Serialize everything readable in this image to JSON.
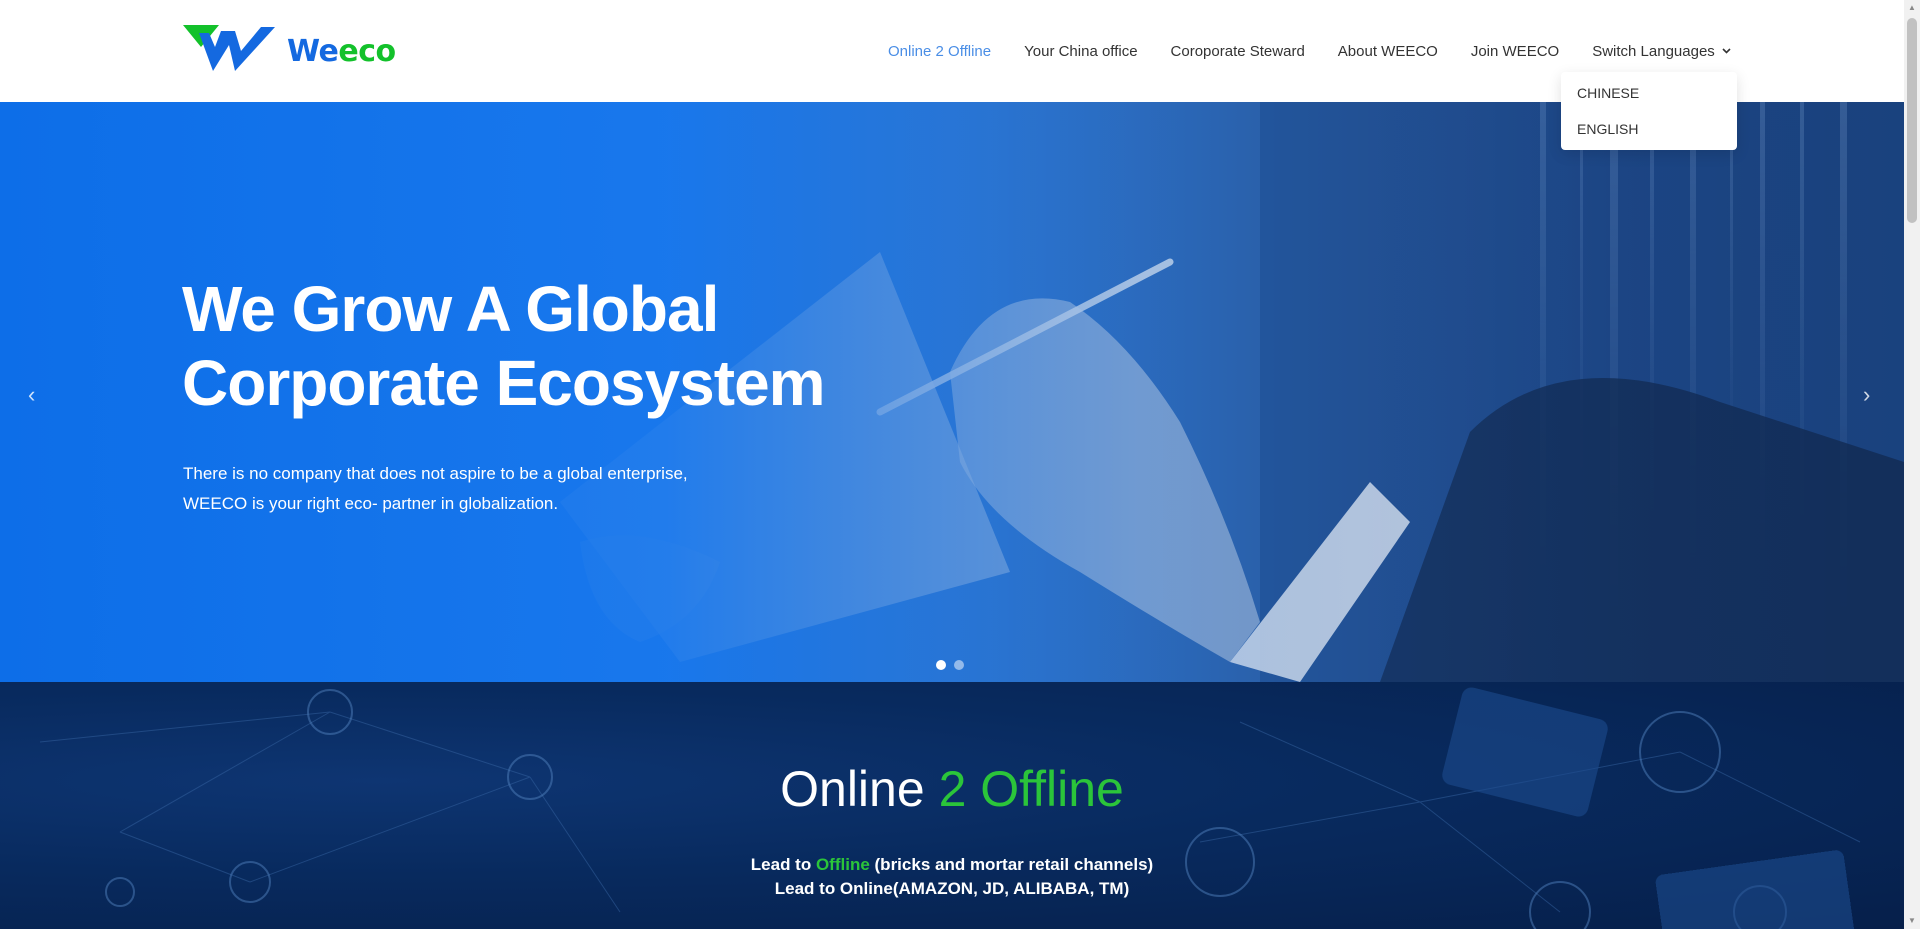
{
  "brand": {
    "name_w": "We",
    "name_rest": "eco",
    "colors": {
      "blue": "#1469e0",
      "green": "#13c12b"
    }
  },
  "nav": {
    "items": [
      {
        "label": "Online 2 Offline",
        "active": true
      },
      {
        "label": "Your China office"
      },
      {
        "label": "Coroporate Steward"
      },
      {
        "label": "About WEECO"
      },
      {
        "label": "Join WEECO"
      }
    ],
    "lang_label": "Switch Languages",
    "lang_options": [
      "CHINESE",
      "ENGLISH"
    ]
  },
  "hero": {
    "title_line1": "We Grow A Global",
    "title_line2": "Corporate Ecosystem",
    "text_line1": "There is no company that does not aspire to be a global enterprise,",
    "text_line2": "WEECO is your right eco- partner in globalization.",
    "prev_icon": "‹",
    "next_icon": "›",
    "slides": 2,
    "active_slide": 1
  },
  "section2": {
    "title_white": "Online ",
    "title_green": "2 Offline",
    "line1_a": "Lead to ",
    "line1_green": "Offline",
    "line1_b": " (bricks and mortar retail channels)",
    "line2": "Lead to Online(AMAZON, JD, ALIBABA, TM)"
  }
}
